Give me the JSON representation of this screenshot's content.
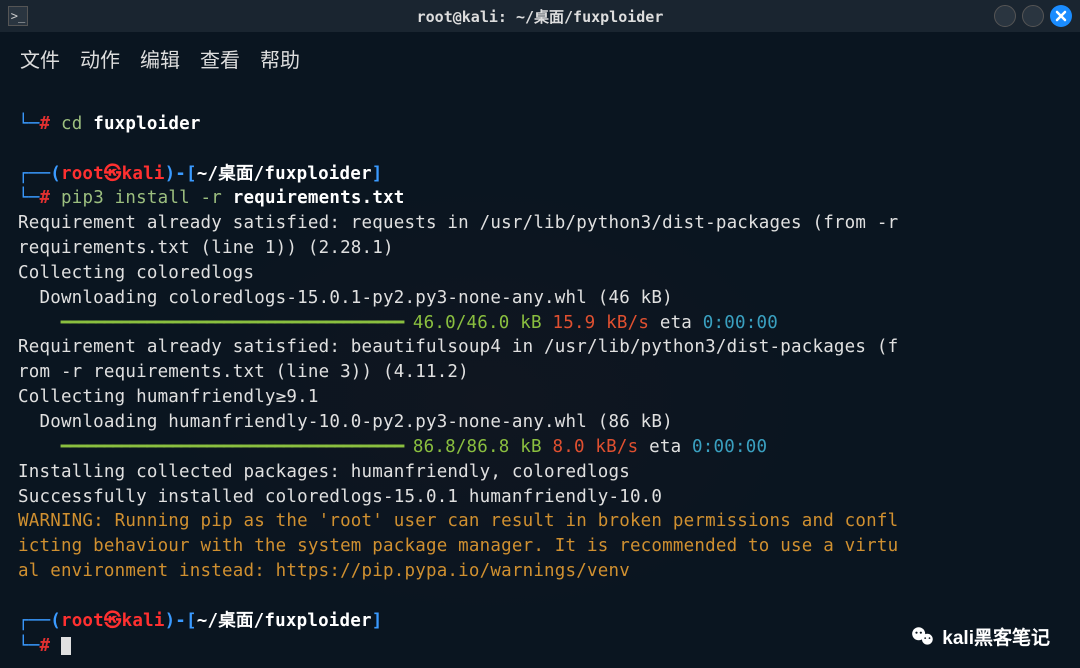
{
  "titlebar": {
    "title": "root@kali: ~/桌面/fuxploider"
  },
  "menu": {
    "file": "文件",
    "actions": "动作",
    "edit": "编辑",
    "view": "查看",
    "help": "帮助"
  },
  "prompt": {
    "user": "root",
    "host": "kali",
    "skull": "💀",
    "path": "~/桌面/fuxploider",
    "hash": "#"
  },
  "cmd": {
    "cd": "cd ",
    "cd_arg": "fuxploider",
    "pip": "pip3 install -r ",
    "pip_arg": "requirements.txt"
  },
  "out": {
    "req_requests": "Requirement already satisfied: requests in /usr/lib/python3/dist-packages (from -r \nrequirements.txt (line 1)) (2.28.1)",
    "collect_coloredlogs": "Collecting coloredlogs",
    "dl_coloredlogs": "  Downloading coloredlogs-15.0.1-py2.py3-none-any.whl (46 kB)",
    "bar1": "     ━━━━━━━━━━━━━━━━━━━━━━━━━━━━━━━━━━━━━━━━",
    "bar1_size": "46.0/46.0 kB",
    "bar1_speed": "15.9 kB/s",
    "bar1_eta_lbl": " eta ",
    "bar1_eta": "0:00:00",
    "req_bs4": "Requirement already satisfied: beautifulsoup4 in /usr/lib/python3/dist-packages (f\nrom -r requirements.txt (line 3)) (4.11.2)",
    "collect_humanfriendly": "Collecting humanfriendly≥9.1",
    "dl_humanfriendly": "  Downloading humanfriendly-10.0-py2.py3-none-any.whl (86 kB)",
    "bar2": "     ━━━━━━━━━━━━━━━━━━━━━━━━━━━━━━━━━━━━━━━━",
    "bar2_size": "86.8/86.8 kB",
    "bar2_speed": "8.0 kB/s",
    "bar2_eta_lbl": " eta ",
    "bar2_eta": "0:00:00",
    "installing": "Installing collected packages: humanfriendly, coloredlogs",
    "success": "Successfully installed coloredlogs-15.0.1 humanfriendly-10.0",
    "warning": "WARNING: Running pip as the 'root' user can result in broken permissions and confl\nicting behaviour with the system package manager. It is recommended to use a virtu\nal environment instead: https://pip.pypa.io/warnings/venv"
  },
  "watermark": {
    "text": "kali黑客笔记"
  }
}
